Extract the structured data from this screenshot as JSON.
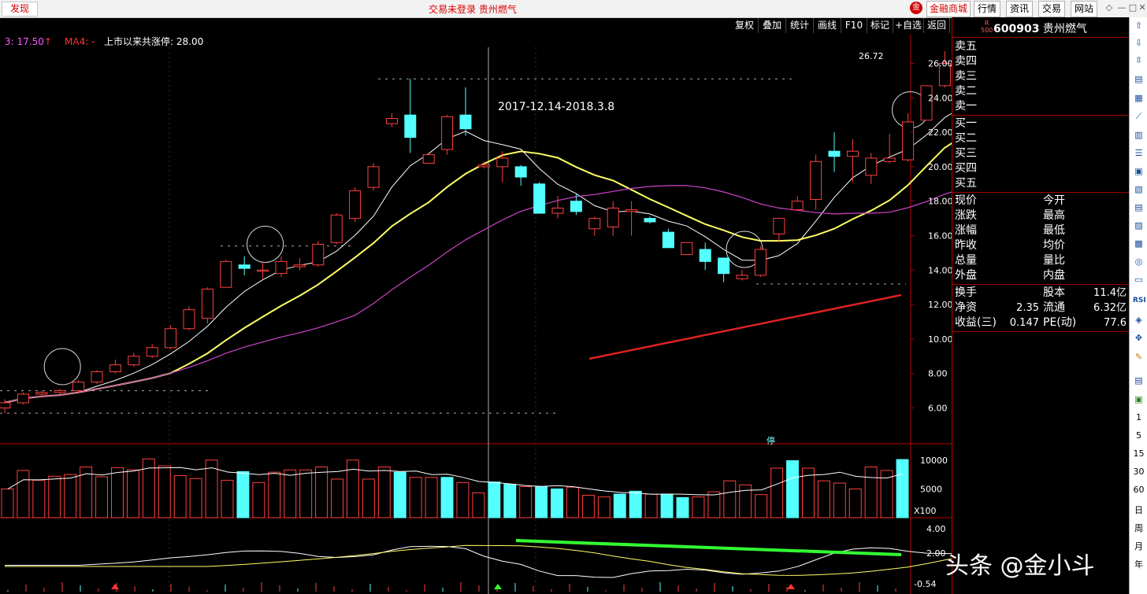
{
  "topbar": {
    "left_button": "发现",
    "title": "交易未登录  贵州燃气",
    "mall_badge": "金",
    "mall": "金融商城",
    "buttons": [
      "行情",
      "资讯",
      "交易",
      "网站"
    ],
    "win": [
      "◇",
      "—",
      "□",
      "✕"
    ]
  },
  "toolbar": [
    "复权",
    "叠加",
    "统计",
    "画线",
    "F10",
    "标记",
    "+自选",
    "返回"
  ],
  "chart_data": {
    "type": "candlestick",
    "symbol": "600903",
    "name": "贵州燃气",
    "indicator_text": {
      "ma_label1": "3: 17.50",
      "ma_arrow": "↑",
      "ma_label2": "MA4: -",
      "limit_up": "上市以来共涨停: 28.00"
    },
    "annotation": "2017-12.14-2018.3.8",
    "high_label": "26.72",
    "ylim": [
      4,
      27
    ],
    "price_ticks": [
      "26.00",
      "24.00",
      "22.00",
      "20.00",
      "18.00",
      "16.00",
      "14.00",
      "12.00",
      "10.00",
      "8.00",
      "6.00"
    ],
    "volume_ticks": [
      "10000",
      "5000"
    ],
    "volume_unit": "X100",
    "indicator_ticks": [
      "4.00",
      "2.00"
    ],
    "indicator_current": "-0.54",
    "limit_marker": "停",
    "candles": [
      [
        6.0,
        6.5,
        5.7,
        6.3
      ],
      [
        6.3,
        6.9,
        6.2,
        6.8
      ],
      [
        6.8,
        7.0,
        6.6,
        6.9
      ],
      [
        6.9,
        7.1,
        6.8,
        7.0
      ],
      [
        7.0,
        7.6,
        6.9,
        7.5
      ],
      [
        7.5,
        8.2,
        7.4,
        8.1
      ],
      [
        8.1,
        8.8,
        8.0,
        8.5
      ],
      [
        8.5,
        9.2,
        8.4,
        9.0
      ],
      [
        9.0,
        9.7,
        8.9,
        9.5
      ],
      [
        9.5,
        10.8,
        9.4,
        10.6
      ],
      [
        10.6,
        11.9,
        10.5,
        11.7
      ],
      [
        11.2,
        13.0,
        10.9,
        12.9
      ],
      [
        13.0,
        14.6,
        13.0,
        14.5
      ],
      [
        14.3,
        14.8,
        13.7,
        14.1
      ],
      [
        14.0,
        14.5,
        13.5,
        14.0
      ],
      [
        13.8,
        14.8,
        13.6,
        14.5
      ],
      [
        14.2,
        14.7,
        14.0,
        14.3
      ],
      [
        14.3,
        15.7,
        14.2,
        15.5
      ],
      [
        15.6,
        17.3,
        15.5,
        17.2
      ],
      [
        17.0,
        18.8,
        16.8,
        18.6
      ],
      [
        18.8,
        20.2,
        18.6,
        20.0
      ],
      [
        22.5,
        23.1,
        22.3,
        22.8
      ],
      [
        23.0,
        25.1,
        20.8,
        21.7
      ],
      [
        20.2,
        20.8,
        20.2,
        20.7
      ],
      [
        21.0,
        23.0,
        20.7,
        22.9
      ],
      [
        23.0,
        24.6,
        21.8,
        22.2
      ],
      [
        20.0,
        20.3,
        19.9,
        20.1
      ],
      [
        20.0,
        20.9,
        19.1,
        20.5
      ],
      [
        20.0,
        20.1,
        18.9,
        19.4
      ],
      [
        19.0,
        19.1,
        17.3,
        17.3
      ],
      [
        17.3,
        18.3,
        17.0,
        17.6
      ],
      [
        18.0,
        18.4,
        17.2,
        17.4
      ],
      [
        16.4,
        17.1,
        16.0,
        17.0
      ],
      [
        16.5,
        18.0,
        16.0,
        17.6
      ],
      [
        17.4,
        18.0,
        16.0,
        17.5
      ],
      [
        17.0,
        17.1,
        16.7,
        16.8
      ],
      [
        16.2,
        16.4,
        15.3,
        15.3
      ],
      [
        14.9,
        15.6,
        14.9,
        15.6
      ],
      [
        15.2,
        15.6,
        14.0,
        14.5
      ],
      [
        14.7,
        14.7,
        13.3,
        13.8
      ],
      [
        13.5,
        14.0,
        13.4,
        13.7
      ],
      [
        13.7,
        15.4,
        13.6,
        15.2
      ],
      [
        16.1,
        17.0,
        15.6,
        17.0
      ],
      [
        17.5,
        18.3,
        17.5,
        18.0
      ],
      [
        18.1,
        20.7,
        17.5,
        20.3
      ],
      [
        20.9,
        22.0,
        19.7,
        20.6
      ],
      [
        20.6,
        21.6,
        19.1,
        20.9
      ],
      [
        19.5,
        20.8,
        19.0,
        20.5
      ],
      [
        20.3,
        21.9,
        20.2,
        20.5
      ],
      [
        20.4,
        23.1,
        20.3,
        22.6
      ],
      [
        22.7,
        24.7,
        22.7,
        24.7
      ],
      [
        24.7,
        26.7,
        24.6,
        26.0
      ],
      [
        24.4,
        26.7,
        23.7,
        23.7
      ]
    ],
    "volumes": [
      5000,
      8200,
      6500,
      7200,
      7500,
      8800,
      7100,
      8700,
      8300,
      10200,
      9000,
      7300,
      6800,
      10000,
      6500,
      8000,
      6100,
      7900,
      8300,
      8300,
      8800,
      6700,
      10000,
      6700,
      8800,
      7900,
      7000,
      7000,
      7000,
      6100,
      4300,
      6200,
      5800,
      5400,
      5400,
      5000,
      5300,
      3900,
      3600,
      4100,
      4600,
      4100,
      4100,
      3500,
      3600,
      4500,
      6400,
      5700,
      4000,
      8600,
      9900,
      8600,
      6400,
      6000,
      5000,
      8800,
      8200,
      10100
    ]
  },
  "quote": {
    "code": "600903",
    "name": "贵州燃气",
    "badge_top": "R",
    "badge_bottom": "500",
    "asks": [
      "卖五",
      "卖四",
      "卖三",
      "卖二",
      "卖一"
    ],
    "bids": [
      "买一",
      "买二",
      "买三",
      "买四",
      "买五"
    ],
    "left_labels": [
      "现价",
      "涨跌",
      "涨幅",
      "昨收",
      "总量",
      "外盘"
    ],
    "right_labels": [
      "今开",
      "最高",
      "最低",
      "均价",
      "量比",
      "内盘"
    ],
    "stats": [
      {
        "l1": "换手",
        "v1": "",
        "l2": "股本",
        "v2": "11.4亿"
      },
      {
        "l1": "净资",
        "v1": "2.35",
        "l2": "流通",
        "v2": "6.32亿"
      },
      {
        "l1": "收益(三)",
        "v1": "0.147",
        "l2": "PE(动)",
        "v2": "77.6"
      }
    ]
  },
  "sidebar": {
    "periods": [
      "1",
      "5",
      "15",
      "30",
      "60",
      "日",
      "周",
      "月",
      "年"
    ]
  },
  "watermark": "头条 @金小斗"
}
